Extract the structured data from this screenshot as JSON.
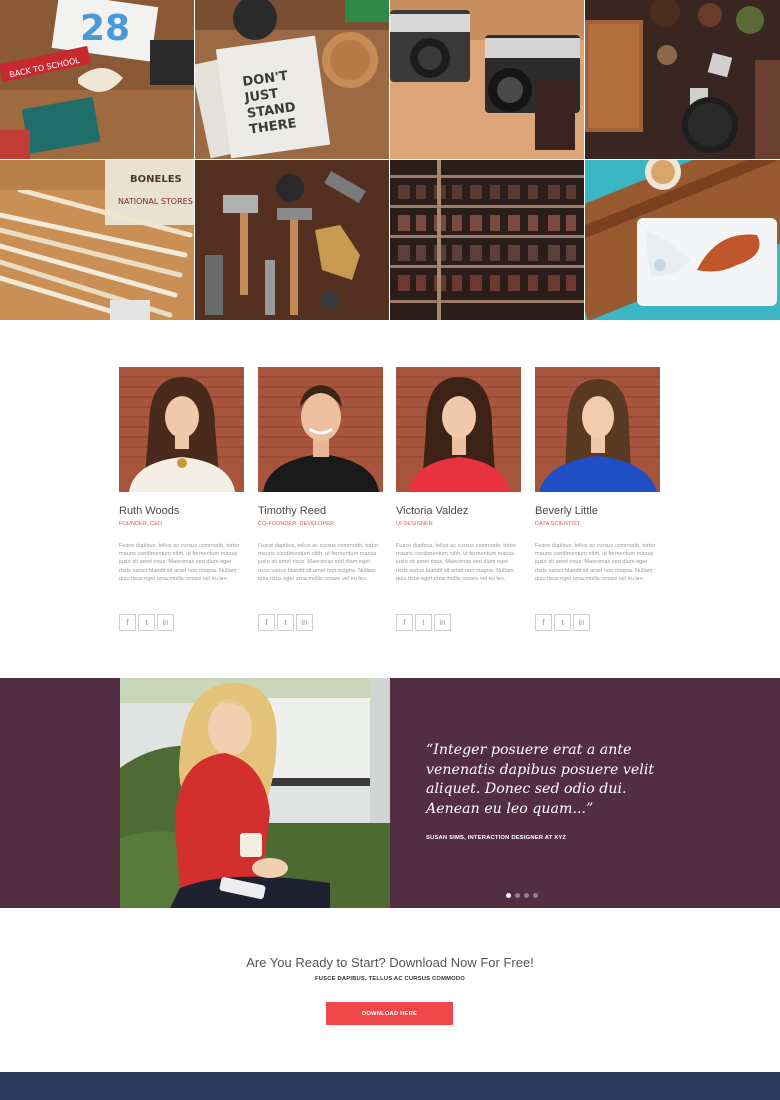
{
  "gallery": {
    "tiles": [
      {
        "name": "gallery-photo-stationery"
      },
      {
        "name": "gallery-photo-notebook"
      },
      {
        "name": "gallery-photo-cameras"
      },
      {
        "name": "gallery-photo-kitchen"
      },
      {
        "name": "gallery-photo-pencils"
      },
      {
        "name": "gallery-photo-tools"
      },
      {
        "name": "gallery-photo-letterpress"
      },
      {
        "name": "gallery-photo-food"
      }
    ],
    "notebook_text": "DON'T JUST STAND THERE",
    "stationery_text": "BACK TO SCHOOL",
    "pencils_text": "BONELES"
  },
  "team": {
    "members": [
      {
        "name": "Ruth Woods",
        "role": "FOUNDER, CEO",
        "bio": "Fusce dapibus, tellus ac cursus commodo, tortor mauris condimentum nibh, ut fermentum massa justo sit amet risus. Maecenas sed diam eget risus varius blandit sit amet non magna. Nullam quis risus eget urna mollis ornare vel eu leo.",
        "shirt_color": "#f4efe4",
        "hair_color": "#4a2a1c"
      },
      {
        "name": "Timothy Reed",
        "role": "CO-FOUNDER, DEVELOPER",
        "bio": "Fusce dapibus, tellus ac cursus commodo, tortor mauris condimentum nibh, ut fermentum massa justo sit amet risus. Maecenas sed diam eget risus varius blandit sit amet non magna. Nullam quis risus eget urna mollis ornare vel eu leo.",
        "shirt_color": "#1a1a1a",
        "hair_color": "#3a2418"
      },
      {
        "name": "Victoria Valdez",
        "role": "UI DESIGNER",
        "bio": "Fusce dapibus, tellus ac cursus commodo, tortor mauris condimentum nibh, ut fermentum massa justo sit amet risus. Maecenas sed diam eget risus varius blandit sit amet non magna. Nullam quis risus eget urna mollis ornare vel eu leo.",
        "shirt_color": "#e8323f",
        "hair_color": "#3d2217"
      },
      {
        "name": "Beverly Little",
        "role": "DATA SCIENTIST",
        "bio": "Fusce dapibus, tellus ac cursus commodo, tortor mauris condimentum nibh, ut fermentum massa justo sit amet risus. Maecenas sed diam eget risus varius blandit sit amet non magna. Nullam quis risus eget urna mollis ornare vel eu leo.",
        "shirt_color": "#1f4fc4",
        "hair_color": "#5a3a22"
      }
    ],
    "social": {
      "facebook": "f",
      "twitter": "t",
      "linkedin": "in"
    }
  },
  "testimonial": {
    "quote": "“Integer posuere erat a ante venenatis dapibus posuere velit aliquet. Donec sed odio dui. Aenean eu leo quam...”",
    "author": "SUSAN SIMS, INTERACTION DESIGNER AT XYZ",
    "slides": 4,
    "active_slide": 1,
    "background_color": "#532e43"
  },
  "cta": {
    "title": "Are You Ready to Start? Download Now For Free!",
    "subtitle": "FUSCE DAPIBUS, TELLUS AC CURSUS COMMODO",
    "button_label": "DOWNLOAD HERE",
    "button_color": "#f0474a"
  },
  "colors": {
    "accent": "#e25555",
    "footer": "#2e3a5c",
    "brick": "#a8553d"
  }
}
